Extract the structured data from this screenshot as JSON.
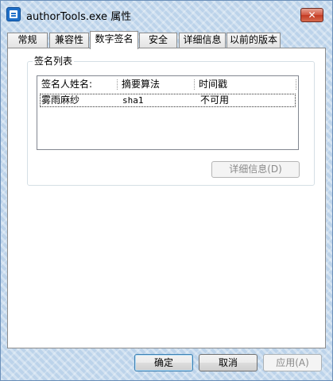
{
  "window": {
    "title": "authorTools.exe 属性",
    "close_label": "✕"
  },
  "tabs": [
    {
      "label": "常规",
      "active": false
    },
    {
      "label": "兼容性",
      "active": false
    },
    {
      "label": "数字签名",
      "active": true
    },
    {
      "label": "安全",
      "active": false
    },
    {
      "label": "详细信息",
      "active": false
    },
    {
      "label": "以前的版本",
      "active": false
    }
  ],
  "signature_list": {
    "legend": "签名列表",
    "columns": [
      "签名人姓名:",
      "摘要算法",
      "时间戳"
    ],
    "rows": [
      {
        "signer": "雾雨麻纱",
        "digest": "sha1",
        "timestamp": "不可用",
        "selected": true
      }
    ],
    "details_label": "详细信息(D)"
  },
  "buttons": {
    "ok_label": "确定",
    "cancel_label": "取消",
    "apply_label": "应用(A)"
  }
}
